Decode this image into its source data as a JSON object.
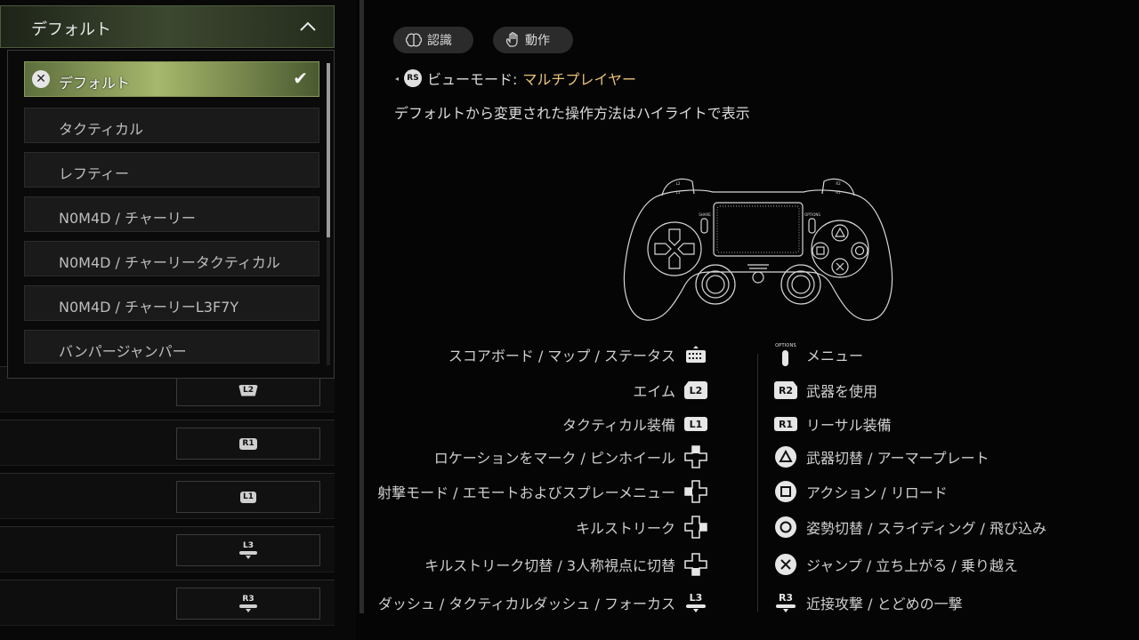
{
  "preset_dropdown": {
    "selected_label": "デフォルト",
    "options": [
      {
        "label": "デフォルト",
        "selected": true
      },
      {
        "label": "タクティカル",
        "selected": false
      },
      {
        "label": "レフティー",
        "selected": false
      },
      {
        "label": "N0M4D / チャーリー",
        "selected": false
      },
      {
        "label": "N0M4D / チャーリータクティカル",
        "selected": false
      },
      {
        "label": "N0M4D / チャーリーL3F7Y",
        "selected": false
      },
      {
        "label": "バンパージャンパー",
        "selected": false
      }
    ]
  },
  "binding_rows": [
    {
      "button": "L2"
    },
    {
      "button": "R1"
    },
    {
      "button": "L1"
    },
    {
      "button": "L3"
    },
    {
      "button": "R3"
    }
  ],
  "tabs": [
    {
      "label": "認識",
      "icon": "brain-icon"
    },
    {
      "label": "動作",
      "icon": "hand-icon"
    }
  ],
  "view_mode": {
    "button": "RS",
    "label": "ビューモード:",
    "value": "マルチプレイヤー"
  },
  "hint": "デフォルトから変更された操作方法はハイライトで表示",
  "controller_labels": {
    "share": "SHARE",
    "options": "OPTIONS",
    "l2": "L2",
    "r2": "R2",
    "l1": "L1",
    "r1": "R1"
  },
  "left_bindings": [
    {
      "action": "スコアボード / マップ / ステータス",
      "button": "touchpad"
    },
    {
      "action": "エイム",
      "button": "L2"
    },
    {
      "action": "タクティカル装備",
      "button": "L1"
    },
    {
      "action": "ロケーションをマーク / ピンホイール",
      "button": "dpad-up"
    },
    {
      "action": "射撃モード / エモートおよびスプレーメニュー",
      "button": "dpad-left"
    },
    {
      "action": "キルストリーク",
      "button": "dpad-right"
    },
    {
      "action": "キルストリーク切替 / 3人称視点に切替",
      "button": "dpad-down"
    },
    {
      "action": "ダッシュ / タクティカルダッシュ / フォーカス",
      "button": "L3"
    }
  ],
  "right_bindings": [
    {
      "action": "メニュー",
      "button": "OPTIONS"
    },
    {
      "action": "武器を使用",
      "button": "R2"
    },
    {
      "action": "リーサル装備",
      "button": "R1"
    },
    {
      "action": "武器切替 / アーマープレート",
      "button": "triangle"
    },
    {
      "action": "アクション / リロード",
      "button": "square"
    },
    {
      "action": "姿勢切替 / スライディング / 飛び込み",
      "button": "circle"
    },
    {
      "action": "ジャンプ / 立ち上がる / 乗り越え",
      "button": "cross"
    },
    {
      "action": "近接攻撃 / とどめの一撃",
      "button": "R3"
    }
  ],
  "colors": {
    "accent_olive": "#a6b86c",
    "value_gold": "#e8c27a"
  }
}
